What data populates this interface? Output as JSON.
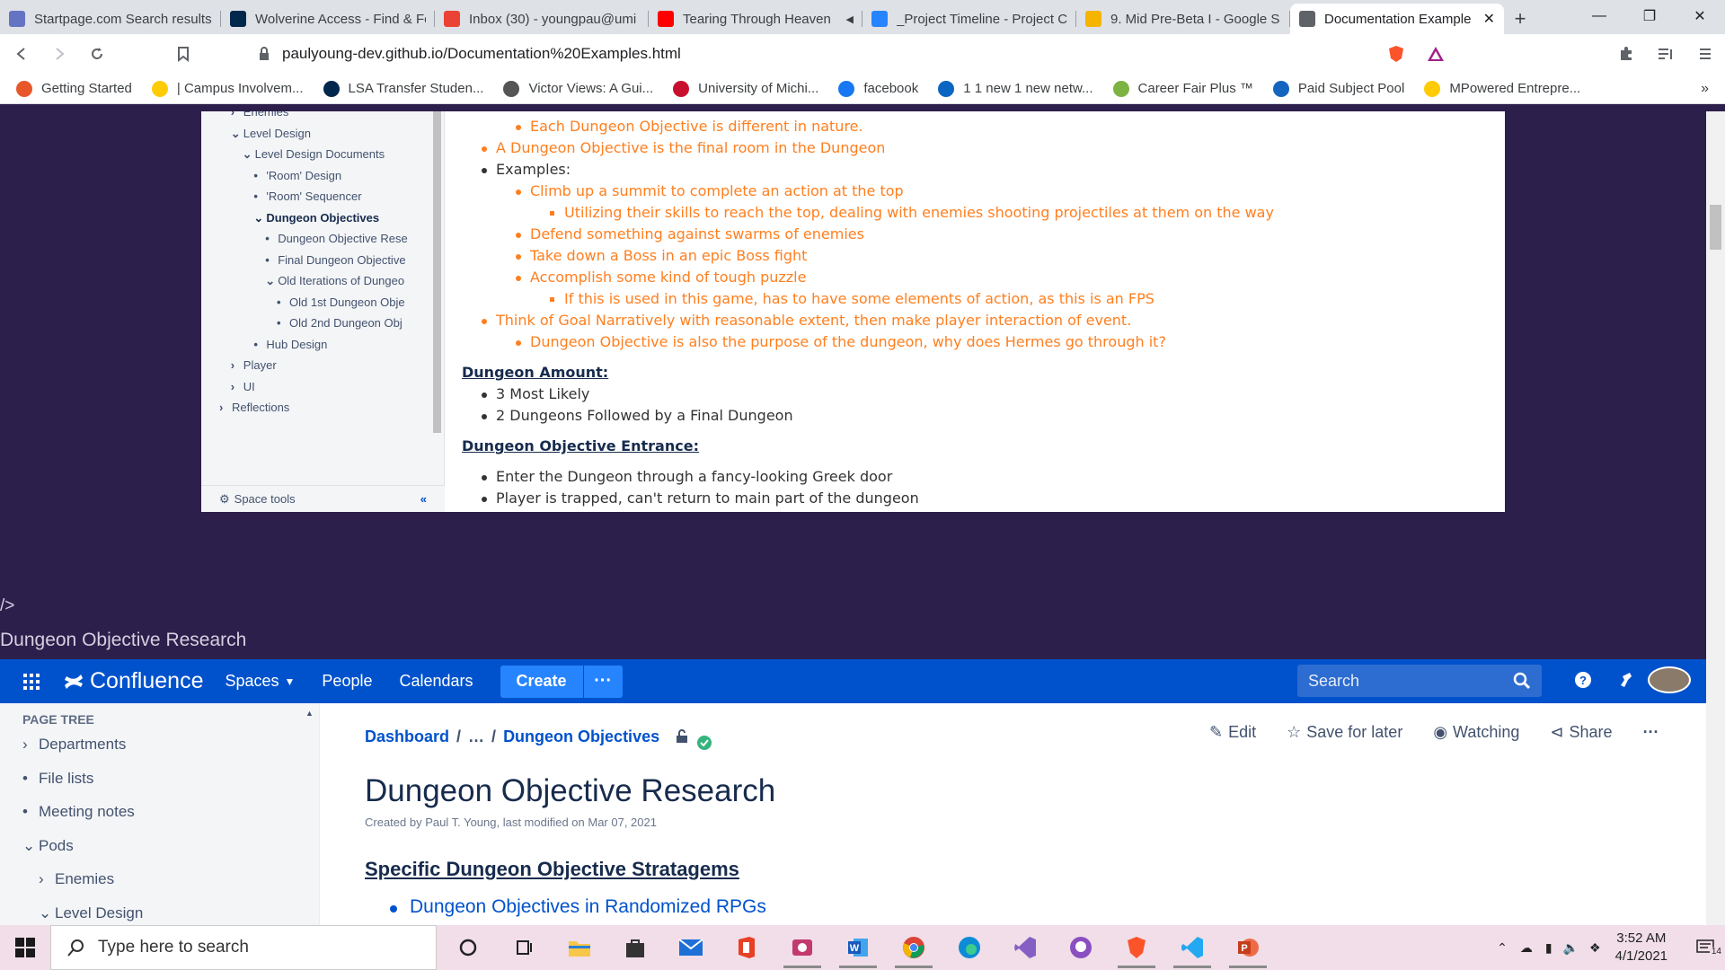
{
  "browser": {
    "tabs": [
      {
        "title": "Startpage.com Search results",
        "color": "#6573c3"
      },
      {
        "title": "Wolverine Access - Find & Fe",
        "color": "#00274c"
      },
      {
        "title": "Inbox (30) - youngpau@umi",
        "color": "#ea4335"
      },
      {
        "title": "Tearing Through Heaven",
        "color": "#ff0000"
      },
      {
        "title": "_Project Timeline - Project C",
        "color": "#2684ff"
      },
      {
        "title": "9. Mid Pre-Beta I - Google S",
        "color": "#f4b400"
      },
      {
        "title": "Documentation Example",
        "color": "#5f6368"
      }
    ],
    "url": "paulyoung-dev.github.io/Documentation%20Examples.html",
    "bookmarks": [
      {
        "label": "Getting Started",
        "color": "#e8572a"
      },
      {
        "label": "| Campus Involvem...",
        "color": "#ffcb05"
      },
      {
        "label": "LSA Transfer Studen...",
        "color": "#00274c"
      },
      {
        "label": "Victor Views: A Gui...",
        "color": "#555555"
      },
      {
        "label": "University of Michi...",
        "color": "#c8102e"
      },
      {
        "label": "facebook",
        "color": "#1877f2"
      },
      {
        "label": "1 1 new 1 new netw...",
        "color": "#0a66c2"
      },
      {
        "label": "Career Fair Plus ™",
        "color": "#7cb342"
      },
      {
        "label": "Paid Subject Pool",
        "color": "#1565c0"
      },
      {
        "label": "MPowered Entrepre...",
        "color": "#ffcb05"
      }
    ]
  },
  "shot": {
    "tree": {
      "items": [
        {
          "label": "Enemies",
          "chev": "right"
        },
        {
          "label": "Level Design",
          "chev": "down"
        },
        {
          "label": "Level Design Documents",
          "chev": "down"
        },
        {
          "label": "'Room' Design",
          "chev": "dot"
        },
        {
          "label": "'Room' Sequencer",
          "chev": "dot"
        },
        {
          "label": "Dungeon Objectives",
          "chev": "down",
          "bold": true
        },
        {
          "label": "Dungeon Objective Rese",
          "chev": "dot"
        },
        {
          "label": "Final Dungeon Objective",
          "chev": "dot"
        },
        {
          "label": "Old Iterations of Dungeo",
          "chev": "down"
        },
        {
          "label": "Old 1st Dungeon Obje",
          "chev": "dot"
        },
        {
          "label": "Old 2nd Dungeon Obj",
          "chev": "dot"
        },
        {
          "label": "Hub Design",
          "chev": "dot"
        },
        {
          "label": "Player",
          "chev": "right"
        },
        {
          "label": "UI",
          "chev": "right"
        },
        {
          "label": "Reflections",
          "chev": "right"
        }
      ],
      "space_tools": "Space tools"
    },
    "lines": [
      {
        "text": "Each Dungeon Objective is different in nature.",
        "style": "o",
        "level": 2
      },
      {
        "text": "A Dungeon Objective is the final room in the Dungeon",
        "style": "o",
        "level": 1
      },
      {
        "text": "Examples:",
        "style": "k",
        "level": 1
      },
      {
        "text": "Climb up a summit to complete an action at the top",
        "style": "o",
        "level": 2
      },
      {
        "text": "Utilizing their skills to reach the top, dealing with enemies shooting projectiles at them on the way",
        "style": "o",
        "level": 3
      },
      {
        "text": "Defend something against swarms of enemies",
        "style": "o",
        "level": 2
      },
      {
        "text": "Take down a Boss in an epic Boss fight",
        "style": "o",
        "level": 2
      },
      {
        "text": "Accomplish some kind of tough puzzle",
        "style": "o",
        "level": 2
      },
      {
        "text": "If this is used in this game, has to have some elements of action, as this is an FPS",
        "style": "o",
        "level": 3
      },
      {
        "text": "Think of Goal Narratively with reasonable extent, then make player interaction of event.",
        "style": "o",
        "level": 1
      },
      {
        "text": "Dungeon Objective is also the purpose of the dungeon, why does Hermes go through it?",
        "style": "o",
        "level": 2
      },
      {
        "text": "Dungeon Amount:",
        "style": "h",
        "level": 0
      },
      {
        "text": "3 Most Likely",
        "style": "k",
        "level": 1
      },
      {
        "text": "2 Dungeons Followed by a Final Dungeon",
        "style": "k",
        "level": 1
      },
      {
        "text": "Dungeon Objective Entrance:",
        "style": "h",
        "level": 0
      },
      {
        "text": "Enter the Dungeon through a fancy-looking Greek door",
        "style": "k",
        "level": 1
      },
      {
        "text": "Player is trapped, can't return to main part of the dungeon",
        "style": "k",
        "level": 1
      }
    ]
  },
  "page": {
    "raw": "/>",
    "title": "Dungeon Objective Research"
  },
  "confluence": {
    "logo": "Confluence",
    "nav": [
      "Spaces",
      "People",
      "Calendars"
    ],
    "create": "Create",
    "search_placeholder": "Search",
    "sidebar_title": "PAGE TREE",
    "sidebar": [
      {
        "label": "Departments",
        "chev": "right"
      },
      {
        "label": "File lists",
        "chev": "dot"
      },
      {
        "label": "Meeting notes",
        "chev": "dot"
      },
      {
        "label": "Pods",
        "chev": "down"
      },
      {
        "label": "Enemies",
        "chev": "right"
      },
      {
        "label": "Level Design",
        "chev": "down"
      }
    ],
    "breadcrumb": {
      "home": "Dashboard",
      "ellipsis": "…",
      "current": "Dungeon Objectives"
    },
    "actions": {
      "edit": "Edit",
      "save": "Save for later",
      "watch": "Watching",
      "share": "Share"
    },
    "page_title": "Dungeon Objective Research",
    "meta": "Created by Paul T. Young, last modified on Mar 07, 2021",
    "section": "Specific Dungeon Objective Stratagems",
    "link": "Dungeon Objectives in Randomized RPGs"
  },
  "taskbar": {
    "search_placeholder": "Type here to search",
    "time": "3:52 AM",
    "date": "4/1/2021",
    "notifications": "14"
  }
}
